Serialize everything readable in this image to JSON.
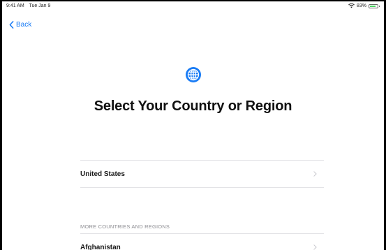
{
  "status_bar": {
    "time": "9:41 AM",
    "date": "Tue Jan 9",
    "battery": "83%",
    "battery_level": 0.83
  },
  "nav": {
    "back_label": "Back"
  },
  "header": {
    "icon": "globe-icon",
    "title": "Select Your Country or Region"
  },
  "suggested": {
    "items": [
      {
        "label": "United States"
      }
    ]
  },
  "more": {
    "header": "MORE COUNTRIES AND REGIONS",
    "items": [
      {
        "label": "Afghanistan"
      }
    ]
  },
  "colors": {
    "accent": "#1a7cf5",
    "battery": "#4cd964",
    "divider": "#e3e3e6",
    "secondary_text": "#8e8e93"
  }
}
